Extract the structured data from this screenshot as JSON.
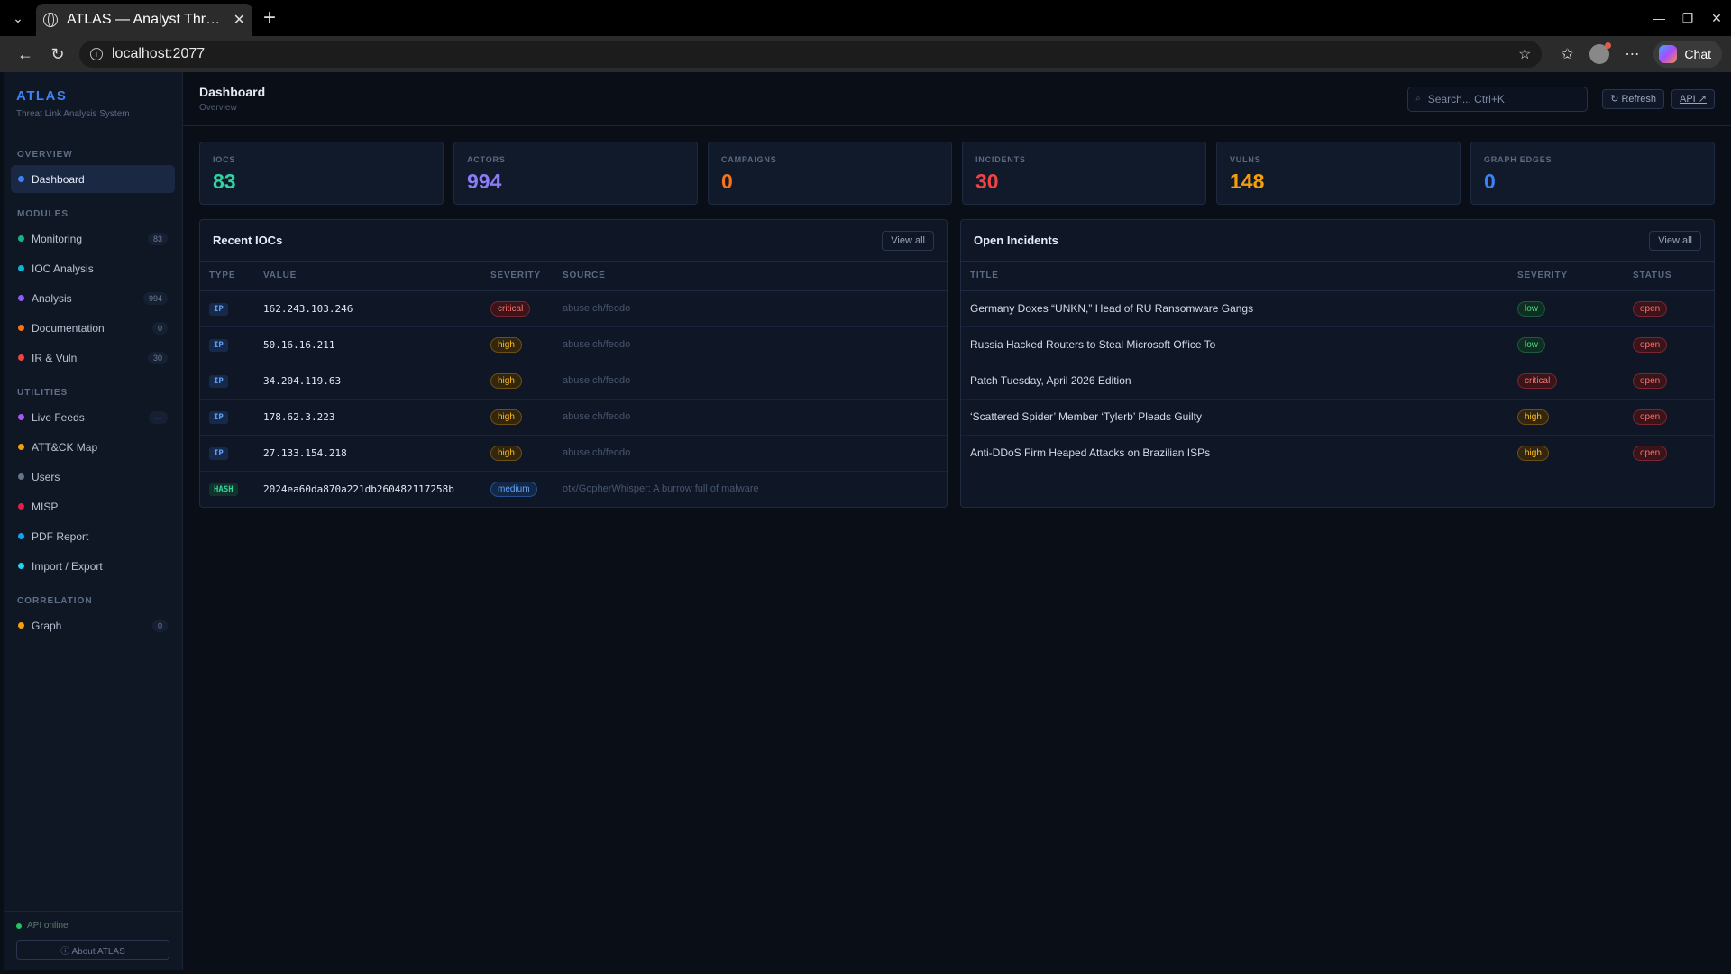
{
  "browser": {
    "tab_title": "ATLAS — Analyst Threat & Link Analysis System",
    "url": "localhost:2077",
    "chat_label": "Chat"
  },
  "sidebar": {
    "brand": "ATLAS",
    "subtitle": "Threat Link Analysis System",
    "sections": {
      "overview": "OVERVIEW",
      "modules": "MODULES",
      "utilities": "UTILITIES",
      "correlation": "CORRELATION"
    },
    "items": [
      {
        "label": "Dashboard",
        "color": "#3b82f6",
        "count": ""
      },
      {
        "label": "Monitoring",
        "color": "#10b981",
        "count": "83"
      },
      {
        "label": "IOC Analysis",
        "color": "#06b6d4",
        "count": ""
      },
      {
        "label": "Analysis",
        "color": "#8b5cf6",
        "count": "994"
      },
      {
        "label": "Documentation",
        "color": "#f97316",
        "count": "0"
      },
      {
        "label": "IR & Vuln",
        "color": "#ef4444",
        "count": "30"
      },
      {
        "label": "Live Feeds",
        "color": "#a855f7",
        "count": "—"
      },
      {
        "label": "ATT&CK Map",
        "color": "#f59e0b",
        "count": ""
      },
      {
        "label": "Users",
        "color": "#64748b",
        "count": ""
      },
      {
        "label": "MISP",
        "color": "#e11d48",
        "count": ""
      },
      {
        "label": "PDF Report",
        "color": "#0ea5e9",
        "count": ""
      },
      {
        "label": "Import / Export",
        "color": "#22d3ee",
        "count": ""
      },
      {
        "label": "Graph",
        "color": "#f59e0b",
        "count": "0"
      }
    ],
    "api_status": "API online",
    "about": "ⓘ About ATLAS"
  },
  "header": {
    "title": "Dashboard",
    "subtitle": "Overview",
    "search_placeholder": "Search... Ctrl+K",
    "refresh": "↻ Refresh",
    "api": "API ↗"
  },
  "stats": [
    {
      "label": "IOCS",
      "value": "83",
      "color": "#2dd4a0"
    },
    {
      "label": "ACTORS",
      "value": "994",
      "color": "#8b7cf6"
    },
    {
      "label": "CAMPAIGNS",
      "value": "0",
      "color": "#f97316"
    },
    {
      "label": "INCIDENTS",
      "value": "30",
      "color": "#ef4444"
    },
    {
      "label": "VULNS",
      "value": "148",
      "color": "#f59e0b"
    },
    {
      "label": "GRAPH EDGES",
      "value": "0",
      "color": "#3b82f6"
    }
  ],
  "iocs": {
    "title": "Recent IOCs",
    "view_all": "View all",
    "columns": [
      "TYPE",
      "VALUE",
      "SEVERITY",
      "SOURCE"
    ],
    "rows": [
      {
        "type": "IP",
        "value": "162.243.103.246",
        "severity": "critical",
        "source": "abuse.ch/feodo"
      },
      {
        "type": "IP",
        "value": "50.16.16.211",
        "severity": "high",
        "source": "abuse.ch/feodo"
      },
      {
        "type": "IP",
        "value": "34.204.119.63",
        "severity": "high",
        "source": "abuse.ch/feodo"
      },
      {
        "type": "IP",
        "value": "178.62.3.223",
        "severity": "high",
        "source": "abuse.ch/feodo"
      },
      {
        "type": "IP",
        "value": "27.133.154.218",
        "severity": "high",
        "source": "abuse.ch/feodo"
      },
      {
        "type": "HASH",
        "value": "2024ea60da870a221db260482117258b",
        "severity": "medium",
        "source": "otx/GopherWhisper: A burrow full of malware"
      }
    ]
  },
  "incidents": {
    "title": "Open Incidents",
    "view_all": "View all",
    "columns": [
      "TITLE",
      "SEVERITY",
      "STATUS"
    ],
    "rows": [
      {
        "title": "Germany Doxes “UNKN,” Head of RU Ransomware Gangs",
        "severity": "low",
        "status": "open"
      },
      {
        "title": "Russia Hacked Routers to Steal Microsoft Office To",
        "severity": "low",
        "status": "open"
      },
      {
        "title": "Patch Tuesday, April 2026 Edition",
        "severity": "critical",
        "status": "open"
      },
      {
        "title": "‘Scattered Spider’ Member ‘Tylerb’ Pleads Guilty",
        "severity": "high",
        "status": "open"
      },
      {
        "title": "Anti-DDoS Firm Heaped Attacks on Brazilian ISPs",
        "severity": "high",
        "status": "open"
      }
    ]
  }
}
